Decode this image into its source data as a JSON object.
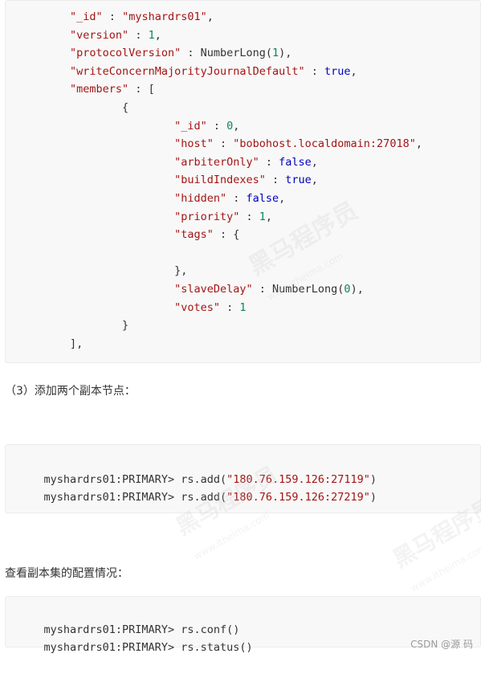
{
  "json_block": {
    "lines": [
      {
        "indent": "        ",
        "key": "\"_id\"",
        "sep": " : ",
        "val": "\"myshardrs01\"",
        "vclass": "k",
        "tail": ","
      },
      {
        "indent": "        ",
        "key": "\"version\"",
        "sep": " : ",
        "val": "1",
        "vclass": "n",
        "tail": ","
      },
      {
        "indent": "        ",
        "key": "\"protocolVersion\"",
        "sep": " : ",
        "pre": "NumberLong(",
        "val": "1",
        "vclass": "n",
        "post": ")",
        "tail": ","
      },
      {
        "indent": "        ",
        "key": "\"writeConcernMajorityJournalDefault\"",
        "sep": " : ",
        "val": "true",
        "vclass": "b",
        "tail": ","
      },
      {
        "indent": "        ",
        "key": "\"members\"",
        "sep": " : ",
        "val": "[",
        "vclass": "",
        "tail": ""
      },
      {
        "indent": "                ",
        "plain": "{"
      },
      {
        "indent": "                        ",
        "key": "\"_id\"",
        "sep": " : ",
        "val": "0",
        "vclass": "n",
        "tail": ","
      },
      {
        "indent": "                        ",
        "key": "\"host\"",
        "sep": " : ",
        "val": "\"bobohost.localdomain:27018\"",
        "vclass": "k",
        "tail": ","
      },
      {
        "indent": "                        ",
        "key": "\"arbiterOnly\"",
        "sep": " : ",
        "val": "false",
        "vclass": "b",
        "tail": ","
      },
      {
        "indent": "                        ",
        "key": "\"buildIndexes\"",
        "sep": " : ",
        "val": "true",
        "vclass": "b",
        "tail": ","
      },
      {
        "indent": "                        ",
        "key": "\"hidden\"",
        "sep": " : ",
        "val": "false",
        "vclass": "b",
        "tail": ","
      },
      {
        "indent": "                        ",
        "key": "\"priority\"",
        "sep": " : ",
        "val": "1",
        "vclass": "n",
        "tail": ","
      },
      {
        "indent": "                        ",
        "key": "\"tags\"",
        "sep": " : ",
        "val": "{",
        "vclass": "",
        "tail": ""
      },
      {
        "indent": "",
        "plain": ""
      },
      {
        "indent": "                        ",
        "plain": "},"
      },
      {
        "indent": "                        ",
        "key": "\"slaveDelay\"",
        "sep": " : ",
        "pre": "NumberLong(",
        "val": "0",
        "vclass": "n",
        "post": ")",
        "tail": ","
      },
      {
        "indent": "                        ",
        "key": "\"votes\"",
        "sep": " : ",
        "val": "1",
        "vclass": "n",
        "tail": ""
      },
      {
        "indent": "                ",
        "plain": "}"
      },
      {
        "indent": "        ",
        "plain": "],"
      }
    ]
  },
  "step3_label": "（3）添加两个副本节点：",
  "add_block": {
    "lines": [
      {
        "prompt": "myshardrs01:PRIMARY> ",
        "cmd": "rs.add(",
        "arg": "\"180.76.159.126:27119\"",
        "end": ")"
      },
      {
        "prompt": "myshardrs01:PRIMARY> ",
        "cmd": "rs.add(",
        "arg": "\"180.76.159.126:27219\"",
        "end": ")"
      }
    ]
  },
  "view_label": "查看副本集的配置情况：",
  "conf_block": {
    "lines": [
      {
        "prompt": "myshardrs01:PRIMARY> ",
        "cmd": "rs.conf()"
      },
      {
        "prompt": "myshardrs01:PRIMARY> ",
        "cmd": "rs.status()"
      }
    ]
  },
  "watermark": {
    "brand": "黑马程序员",
    "site": "www.itheima.com"
  },
  "footer": "CSDN @源  码",
  "colors": {
    "string": "#a31515",
    "number": "#098658",
    "boolean": "#0000c0",
    "text": "#333333"
  }
}
